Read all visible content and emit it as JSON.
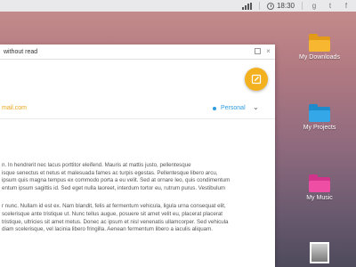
{
  "statusbar": {
    "time": "18:30",
    "social": [
      "g",
      "t",
      "f"
    ]
  },
  "window": {
    "title": "without read",
    "email": "mail.com",
    "account_label": "Personal",
    "paragraphs": [
      [
        "n. In hendrerit nec lacus porttitor eleifend. Mauris at mattis justo, pellentesque",
        "isque senectus et netus et malesuada fames ac turpis egestas. Pellentesque libero arcu,",
        "ipsum quis magna tempus ex commodo porta a eu velit. Sed at ornare leo, quis condimentum",
        "entum ipsum sagittis id. Sed eget nulla laoreet, interdum tortor eu, rutrum purus. Vestibulum"
      ],
      [
        "r nunc. Nullam id est ex. Nam blandit, felis at fermentum vehicula, ligula urna consequat elit,",
        "scelerisque ante tristique ut. Nunc tellus augue, posuere sit amet velit eu, placerat placerat",
        "tristique, ultricies sit amet metus. Donec ac ipsum et nisl venenatis ullamcorper. Sed vehicula",
        "diam scelerisque, vel lacinia libero fringilla. Aenean fermentum libero a iaculis aliquam."
      ]
    ]
  },
  "desktop": [
    {
      "label": "My Downloads",
      "color": "#f7b731",
      "dark": "#e29a18"
    },
    {
      "label": "My Projects",
      "color": "#34a7e8",
      "dark": "#1f8bcc"
    },
    {
      "label": "My Music",
      "color": "#ee4fa4",
      "dark": "#d0348a"
    }
  ]
}
